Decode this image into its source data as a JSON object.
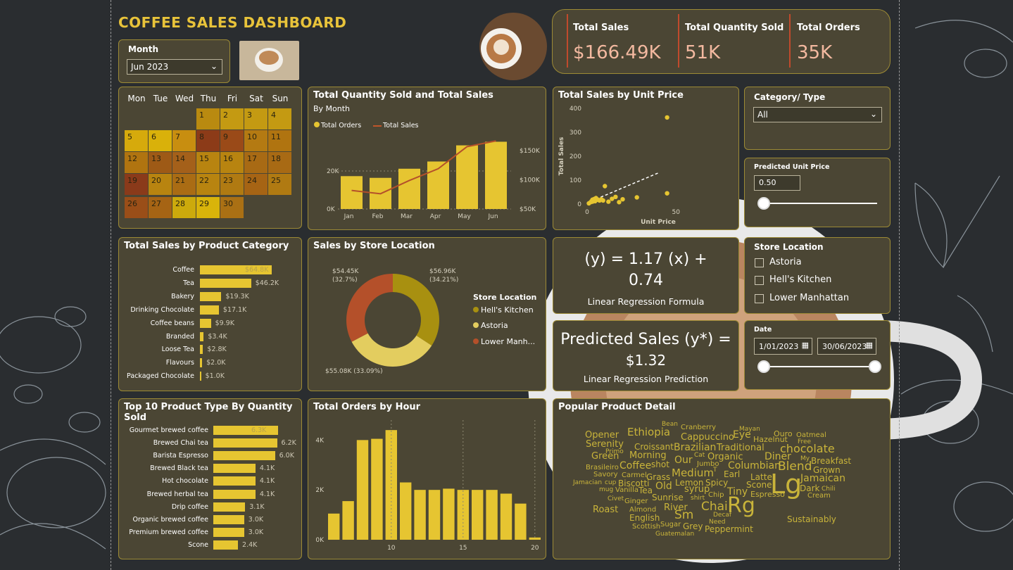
{
  "title": "COFFEE SALES DASHBOARD",
  "month_slicer": {
    "label": "Month",
    "value": "Jun 2023"
  },
  "kpis": [
    {
      "label": "Total Sales",
      "value": "$166.49K"
    },
    {
      "label": "Total Quantity Sold",
      "value": "51K"
    },
    {
      "label": "Total Orders",
      "value": "35K"
    }
  ],
  "calendar": {
    "days": [
      "Mon",
      "Tue",
      "Wed",
      "Thu",
      "Fri",
      "Sat",
      "Sun"
    ],
    "cells": [
      {
        "d": "1",
        "c": "#b98a10"
      },
      {
        "d": "2",
        "c": "#c49a12"
      },
      {
        "d": "3",
        "c": "#c49a12"
      },
      {
        "d": "4",
        "c": "#c49a12"
      },
      {
        "d": "5",
        "c": "#d6aa0c"
      },
      {
        "d": "6",
        "c": "#d9b10a"
      },
      {
        "d": "7",
        "c": "#c88e10"
      },
      {
        "d": "8",
        "c": "#8c3b18"
      },
      {
        "d": "9",
        "c": "#9a4a18"
      },
      {
        "d": "10",
        "c": "#b47a12"
      },
      {
        "d": "11",
        "c": "#b07410"
      },
      {
        "d": "12",
        "c": "#b07410"
      },
      {
        "d": "13",
        "c": "#9e5a16"
      },
      {
        "d": "14",
        "c": "#a4601a"
      },
      {
        "d": "15",
        "c": "#b88410"
      },
      {
        "d": "16",
        "c": "#b88410"
      },
      {
        "d": "17",
        "c": "#a86a14"
      },
      {
        "d": "18",
        "c": "#a86a14"
      },
      {
        "d": "19",
        "c": "#8a3a1a"
      },
      {
        "d": "20",
        "c": "#b88410"
      },
      {
        "d": "21",
        "c": "#aa6c14"
      },
      {
        "d": "22",
        "c": "#b88410"
      },
      {
        "d": "23",
        "c": "#b07a12"
      },
      {
        "d": "24",
        "c": "#a66414"
      },
      {
        "d": "25",
        "c": "#b07a12"
      },
      {
        "d": "26",
        "c": "#9a4e18"
      },
      {
        "d": "27",
        "c": "#a66414"
      },
      {
        "d": "28",
        "c": "#ccaa0c"
      },
      {
        "d": "29",
        "c": "#d9b40a"
      },
      {
        "d": "30",
        "c": "#aa7014"
      }
    ]
  },
  "qty_sales_chart": {
    "title": "Total Quantity Sold and Total Sales",
    "subtitle": "By Month",
    "legend": [
      "Total Orders",
      "Total Sales"
    ],
    "chart_data": {
      "type": "bar",
      "categories": [
        "Jan",
        "Feb",
        "Mar",
        "Apr",
        "May",
        "Jun"
      ],
      "series": [
        {
          "name": "Total Orders",
          "values": [
            17300,
            16400,
            21200,
            25000,
            33500,
            35400
          ]
        },
        {
          "name": "Total Sales",
          "values": [
            81700,
            76100,
            98800,
            118900,
            156700,
            166500
          ]
        }
      ],
      "y_ticks_left": [
        "0K",
        "20K"
      ],
      "y_ticks_right": [
        "$50K",
        "$100K",
        "$150K"
      ]
    }
  },
  "unit_price_chart": {
    "title": "Total Sales by Unit Price",
    "xlabel": "Unit Price",
    "ylabel": "Total Sales",
    "chart_data": {
      "type": "scatter",
      "x": [
        1,
        2,
        2.5,
        3,
        3,
        3.5,
        3.75,
        4,
        4.25,
        4.5,
        5,
        6,
        7,
        8,
        9,
        10,
        12,
        14,
        16,
        18,
        20,
        28,
        45,
        45
      ],
      "y": [
        3,
        8,
        12,
        10,
        18,
        14,
        20,
        16,
        22,
        12,
        25,
        18,
        15,
        20,
        15,
        75,
        10,
        22,
        30,
        8,
        20,
        28,
        45,
        362
      ],
      "x_ticks": [
        "0",
        "50"
      ],
      "y_ticks": [
        "0",
        "100",
        "200",
        "300",
        "400"
      ],
      "xlim": [
        0,
        80
      ],
      "ylim": [
        0,
        400
      ]
    }
  },
  "category_slicer": {
    "label": "Category/ Type",
    "value": "All"
  },
  "predicted_price": {
    "label": "Predicted Unit Price",
    "value": "0.50"
  },
  "product_category": {
    "title": "Total Sales by Product Category",
    "chart_data": {
      "type": "bar",
      "categories": [
        "Coffee",
        "Tea",
        "Bakery",
        "Drinking Chocolate",
        "Coffee beans",
        "Branded",
        "Loose Tea",
        "Flavours",
        "Packaged Chocolate"
      ],
      "values": [
        64.8,
        46.2,
        19.3,
        17.1,
        9.9,
        3.4,
        2.8,
        2.0,
        1.0
      ],
      "labels": [
        "$64.8K",
        "$46.2K",
        "$19.3K",
        "$17.1K",
        "$9.9K",
        "$3.4K",
        "$2.8K",
        "$2.0K",
        "$1.0K"
      ]
    }
  },
  "store_location_chart": {
    "title": "Sales by Store Location",
    "legend_title": "Store Location",
    "legend": [
      "Hell's Kitchen",
      "Astoria",
      "Lower Manh..."
    ],
    "colors": [
      "#a89010",
      "#e3cd5f",
      "#b4502a"
    ],
    "chart_data": {
      "type": "pie",
      "categories": [
        "Hell's Kitchen",
        "Astoria",
        "Lower Manhattan"
      ],
      "values": [
        56.96,
        55.08,
        54.45
      ],
      "labels": [
        "$56.96K\n(34.21%)",
        "$55.08K (33.09%)",
        "$54.45K\n(32.7%)"
      ]
    }
  },
  "formula": {
    "line1": "(y) = 1.17 (x) +",
    "line2": "0.74",
    "caption": "Linear Regression Formula"
  },
  "prediction": {
    "line1": "Predicted Sales (y*) =",
    "line2": "$1.32",
    "caption": "Linear Regression Prediction"
  },
  "store_slicer": {
    "label": "Store Location",
    "options": [
      "Astoria",
      "Hell's Kitchen",
      "Lower Manhattan"
    ]
  },
  "date_slicer": {
    "label": "Date",
    "start": "1/01/2023",
    "end": "30/06/2023"
  },
  "top10": {
    "title": "Top 10 Product Type By Quantity Sold",
    "chart_data": {
      "type": "bar",
      "categories": [
        "Gourmet brewed coffee",
        "Brewed Chai tea",
        "Barista Espresso",
        "Brewed Black tea",
        "Hot chocolate",
        "Brewed herbal tea",
        "Drip coffee",
        "Organic brewed coffee",
        "Premium brewed coffee",
        "Scone"
      ],
      "values": [
        6.3,
        6.2,
        6.0,
        4.1,
        4.1,
        4.1,
        3.1,
        3.0,
        3.0,
        2.4
      ],
      "labels": [
        "6.3K",
        "6.2K",
        "6.0K",
        "4.1K",
        "4.1K",
        "4.1K",
        "3.1K",
        "3.0K",
        "3.0K",
        "2.4K"
      ]
    }
  },
  "orders_by_hour": {
    "title": "Total Orders by Hour",
    "chart_data": {
      "type": "bar",
      "x": [
        6,
        7,
        8,
        9,
        10,
        11,
        12,
        13,
        14,
        15,
        16,
        17,
        18,
        19,
        20
      ],
      "values": [
        1050,
        1550,
        4000,
        4050,
        4400,
        2300,
        2000,
        2000,
        2050,
        2000,
        2000,
        2000,
        1850,
        1450,
        90
      ],
      "x_ticks": [
        "10",
        "15",
        "20"
      ],
      "y_ticks": [
        "0K",
        "2K",
        "4K"
      ],
      "ylim": [
        0,
        4800
      ]
    }
  },
  "word_cloud": {
    "title": "Popular Product Detail",
    "words": [
      {
        "t": "Bean",
        "s": 9
      },
      {
        "t": "Cranberry",
        "s": 10
      },
      {
        "t": "Mayan",
        "s": 9
      },
      {
        "t": "Ouro",
        "s": 11
      },
      {
        "t": "Opener",
        "s": 13
      },
      {
        "t": "Ethiopia",
        "s": 15
      },
      {
        "t": "Cappuccino",
        "s": 13
      },
      {
        "t": "Eye",
        "s": 14
      },
      {
        "t": "Oatmeal",
        "s": 10
      },
      {
        "t": "Serenity",
        "s": 13
      },
      {
        "t": "Hazelnut",
        "s": 11
      },
      {
        "t": "Free",
        "s": 9
      },
      {
        "t": "Croissant",
        "s": 12
      },
      {
        "t": "Brazilian",
        "s": 14
      },
      {
        "t": "Traditional",
        "s": 13
      },
      {
        "t": "chocolate",
        "s": 16
      },
      {
        "t": "Primo",
        "s": 9
      },
      {
        "t": "Green",
        "s": 13
      },
      {
        "t": "Morning",
        "s": 13
      },
      {
        "t": "Cat",
        "s": 9
      },
      {
        "t": "Organic",
        "s": 13
      },
      {
        "t": "Diner",
        "s": 14
      },
      {
        "t": "My",
        "s": 9
      },
      {
        "t": "Breakfast",
        "s": 12
      },
      {
        "t": "Brasileiro",
        "s": 10
      },
      {
        "t": "Coffee",
        "s": 14
      },
      {
        "t": "shot",
        "s": 12
      },
      {
        "t": "Our",
        "s": 14
      },
      {
        "t": "Jumbo",
        "s": 10
      },
      {
        "t": "Columbian",
        "s": 14
      },
      {
        "t": "Blend",
        "s": 17
      },
      {
        "t": "Grown",
        "s": 12
      },
      {
        "t": "Savory",
        "s": 10
      },
      {
        "t": "Carmel",
        "s": 10
      },
      {
        "t": "Grass",
        "s": 12
      },
      {
        "t": "Medium",
        "s": 15
      },
      {
        "t": "T",
        "s": 9
      },
      {
        "t": "Earl",
        "s": 12
      },
      {
        "t": "Latte",
        "s": 12
      },
      {
        "t": "Jamaican",
        "s": 14
      },
      {
        "t": "Jamacian",
        "s": 9
      },
      {
        "t": "cup",
        "s": 9
      },
      {
        "t": "Biscotti",
        "s": 12
      },
      {
        "t": "Lemon",
        "s": 12
      },
      {
        "t": "Spicy",
        "s": 12
      },
      {
        "t": "Scone",
        "s": 12
      },
      {
        "t": "Lg",
        "s": 38
      },
      {
        "t": "Dark",
        "s": 12
      },
      {
        "t": "Chili",
        "s": 9
      },
      {
        "t": "mug",
        "s": 9
      },
      {
        "t": "Vanilla",
        "s": 10
      },
      {
        "t": "Tea",
        "s": 12
      },
      {
        "t": "Old",
        "s": 14
      },
      {
        "t": "syrup",
        "s": 13
      },
      {
        "t": "Chip",
        "s": 10
      },
      {
        "t": "Tiny",
        "s": 14
      },
      {
        "t": "Espresso",
        "s": 11
      },
      {
        "t": "Cream",
        "s": 10
      },
      {
        "t": "Civet",
        "s": 9
      },
      {
        "t": "Ginger",
        "s": 10
      },
      {
        "t": "Sunrise",
        "s": 12
      },
      {
        "t": "shirt",
        "s": 9
      },
      {
        "t": "Roast",
        "s": 13
      },
      {
        "t": "Almond",
        "s": 10
      },
      {
        "t": "River",
        "s": 13
      },
      {
        "t": "Chai",
        "s": 17
      },
      {
        "t": "Rg",
        "s": 30
      },
      {
        "t": "English",
        "s": 12
      },
      {
        "t": "Sm",
        "s": 17
      },
      {
        "t": "Decaf",
        "s": 9
      },
      {
        "t": "Sustainably",
        "s": 12
      },
      {
        "t": "Scottish",
        "s": 10
      },
      {
        "t": "Sugar",
        "s": 10
      },
      {
        "t": "Grey",
        "s": 12
      },
      {
        "t": "Need",
        "s": 9
      },
      {
        "t": "Peppermint",
        "s": 12
      },
      {
        "t": "Guatemalan",
        "s": 9
      }
    ]
  }
}
